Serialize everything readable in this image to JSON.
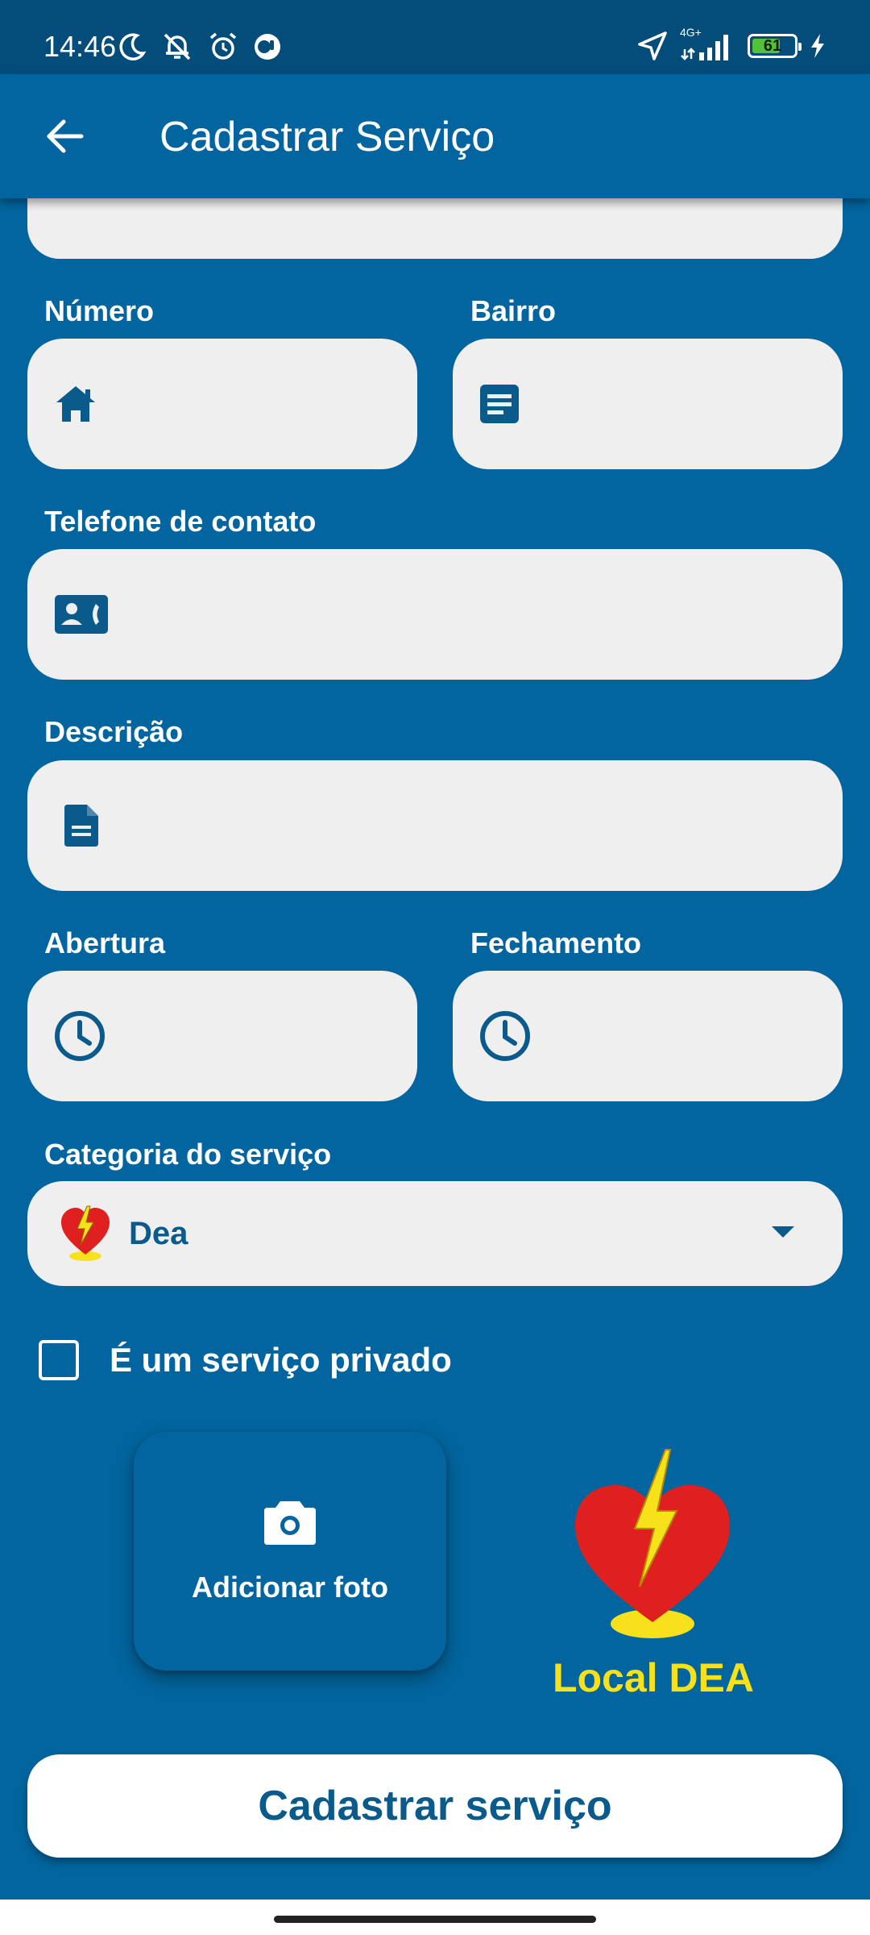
{
  "status_bar": {
    "time": "14:46",
    "network": "4G+",
    "battery": "61"
  },
  "app_bar": {
    "title": "Cadastrar Serviço"
  },
  "form": {
    "numero_label": "Número",
    "bairro_label": "Bairro",
    "telefone_label": "Telefone de contato",
    "descricao_label": "Descrição",
    "abertura_label": "Abertura",
    "fechamento_label": "Fechamento",
    "categoria_label": "Categoria do serviço",
    "categoria_value": "Dea",
    "private_label": "É um serviço privado",
    "private_checked": false
  },
  "actions": {
    "add_photo_label": "Adicionar foto",
    "dea_caption": "Local DEA",
    "submit_label": "Cadastrar serviço"
  },
  "colors": {
    "primary": "#03659f",
    "field_bg": "#efefef",
    "icon": "#0a5a8c",
    "dea_yellow": "#f6e11a",
    "dea_red": "#e0201e"
  }
}
